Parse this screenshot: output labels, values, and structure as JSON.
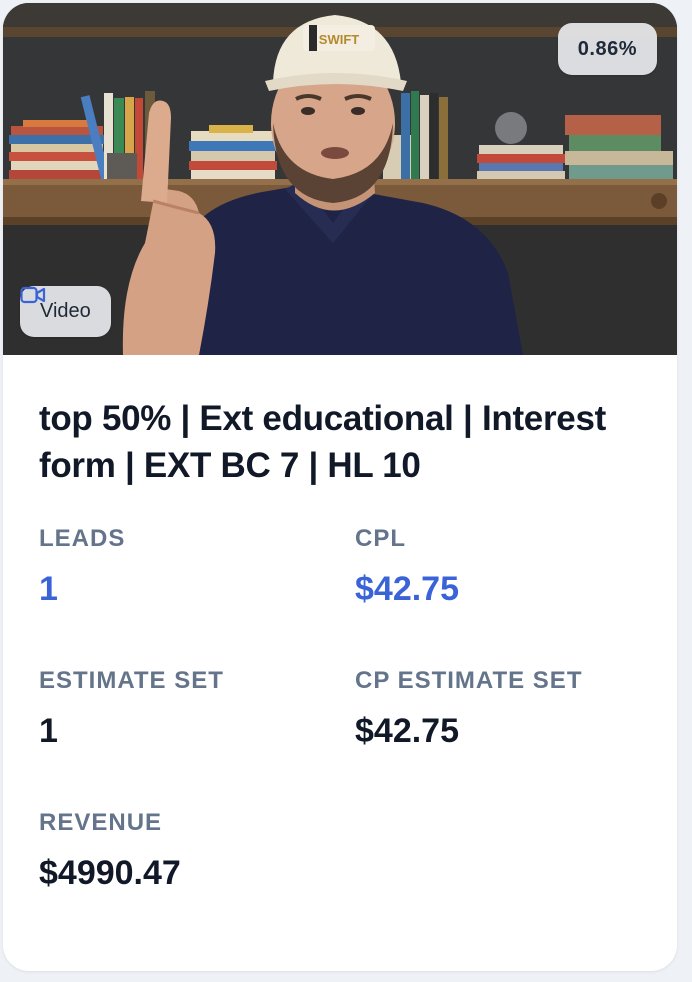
{
  "card": {
    "thumbnail": {
      "percent_badge": "0.86%",
      "media_type_icon": "video-camera-icon",
      "media_type_label": "Video",
      "cap_logo_text": "SWIFT PAINTING"
    },
    "title": "top 50% | Ext educational | Interest form | EXT BC 7 | HL 10",
    "stats": [
      {
        "label": "LEADS",
        "value": "1",
        "accent": true
      },
      {
        "label": "CPL",
        "value": "$42.75",
        "accent": true
      },
      {
        "label": "ESTIMATE SET",
        "value": "1",
        "accent": false
      },
      {
        "label": "CP ESTIMATE SET",
        "value": "$42.75",
        "accent": false
      },
      {
        "label": "REVENUE",
        "value": "$4990.47",
        "accent": false
      }
    ]
  },
  "colors": {
    "accent": "#3b63d8",
    "label": "#64748b",
    "text": "#111827",
    "card_bg": "#ffffff",
    "page_bg": "#eef1f5"
  }
}
